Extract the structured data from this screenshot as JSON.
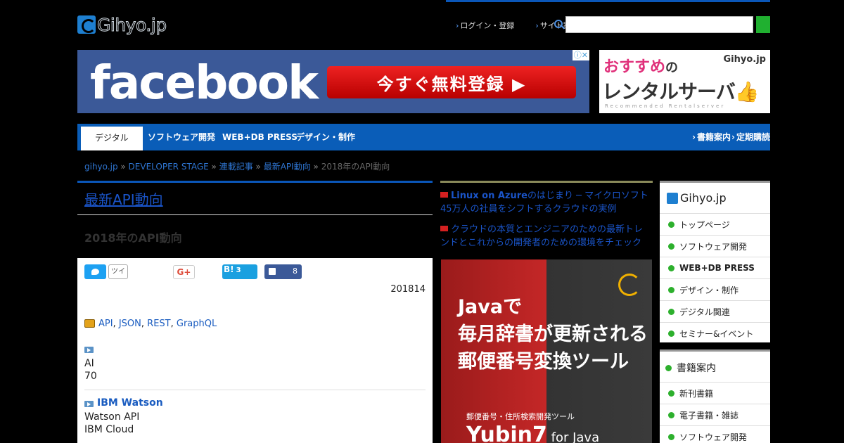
{
  "header": {
    "logo_text": "Gihyo.jp",
    "links": [
      "ログイン・登録",
      "サイト案内"
    ],
    "search_placeholder": ""
  },
  "banners": {
    "facebook": {
      "word": "facebook",
      "cta": "今すぐ無料登録 ▶",
      "ad_marks": "ⓘ✕"
    },
    "rental": {
      "line1": "おすすめ",
      "line1b": "の",
      "line2": "レンタルサーバ👍",
      "line3": "Recommended Rentalserver",
      "logo": "Gihyo.jp"
    }
  },
  "nav": {
    "tabs": [
      "デジタル",
      "ソフトウェア開発",
      "WEB+DB PRESS",
      "デザイン・制作"
    ],
    "right": [
      "書籍案内",
      "定期購読"
    ]
  },
  "breadcrumb": {
    "items": [
      "gihyo.jp",
      "DEVELOPER STAGE",
      "連載記事",
      "最新API動向"
    ],
    "current": "2018年のAPI動向"
  },
  "article": {
    "series_title": "最新API動向",
    "title": "2018年のAPI動向",
    "share": {
      "tweet_count": "ツイ",
      "gplus": "G+",
      "hatena": "B!",
      "hatena_count": "3",
      "fb_count": "8"
    },
    "date": "201814",
    "tags": [
      "API",
      "JSON",
      "REST",
      "GraphQL"
    ],
    "sections": [
      {
        "title": "",
        "lines": [
          "AI",
          "70"
        ]
      },
      {
        "title": "IBM Watson",
        "lines": [
          "Watson API",
          "IBM Cloud"
        ]
      }
    ]
  },
  "middle": {
    "links": [
      {
        "bold": "Linux on Azure",
        "text": "のはじまり ─ マイクロソフト45万人の社員をシフトするクラウドの実例"
      },
      {
        "bold": "",
        "text": "クラウドの本質とエンジニアのための最新トレンドとこれからの開発者のための環境をチェック"
      }
    ],
    "java_ad": {
      "line1": "Javaで",
      "line2": "毎月辞書が更新される",
      "line3": "郵便番号変換ツール",
      "line4": "郵便番号・住所検索開発ツール",
      "line5": "Yubin7",
      "line5b": " for Java"
    }
  },
  "sidebar": {
    "box1": {
      "logo": "Gihyo.jp",
      "items": [
        "トップページ",
        "ソフトウェア開発",
        "WEB+DB PRESS",
        "デザイン・制作",
        "デジタル関連",
        "セミナー&イベント"
      ]
    },
    "box2": {
      "head": "書籍案内",
      "items": [
        "新刊書籍",
        "電子書籍・雑誌",
        "ソフトウェア開発"
      ]
    }
  },
  "colors": {
    "nav_blue": "#0a5db8",
    "link_blue": "#1a54c8",
    "accent_green": "#20b030"
  }
}
